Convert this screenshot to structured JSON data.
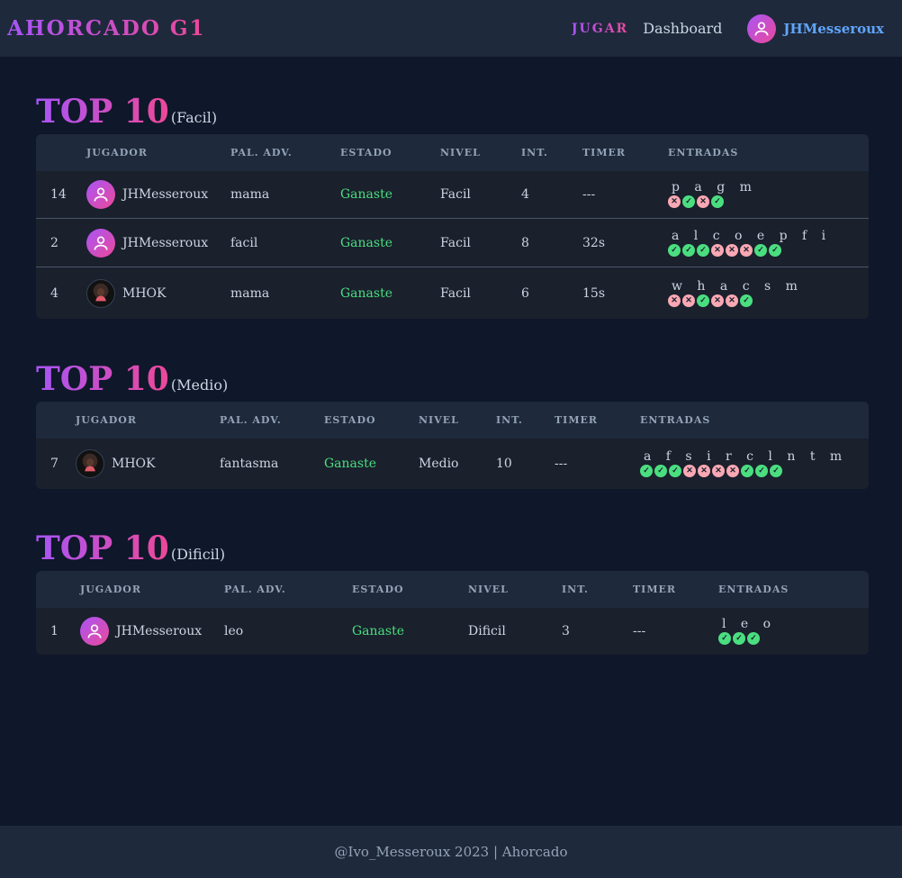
{
  "header": {
    "brand": "AHORCADO G1",
    "nav_play": "JUGAR",
    "nav_dashboard": "Dashboard",
    "username": "JHMesseroux"
  },
  "columns": [
    "JUGADOR",
    "PAL. ADV.",
    "ESTADO",
    "NIVEL",
    "INT.",
    "TIMER",
    "ENTRADAS"
  ],
  "sections": [
    {
      "title": "TOP 10",
      "level": "(Facil)",
      "rows": [
        {
          "rank": "14",
          "player": "JHMesseroux",
          "avatar": "user",
          "word": "mama",
          "status": "Ganaste",
          "level": "Facil",
          "attempts": "4",
          "timer": "---",
          "letters": "p a g m",
          "marks": [
            "bad",
            "ok",
            "bad",
            "ok"
          ]
        },
        {
          "rank": "2",
          "player": "JHMesseroux",
          "avatar": "user",
          "word": "facil",
          "status": "Ganaste",
          "level": "Facil",
          "attempts": "8",
          "timer": "32s",
          "letters": "a l c o e p f i",
          "marks": [
            "ok",
            "ok",
            "ok",
            "bad",
            "bad",
            "bad",
            "ok",
            "ok"
          ]
        },
        {
          "rank": "4",
          "player": "MHOK",
          "avatar": "photo",
          "word": "mama",
          "status": "Ganaste",
          "level": "Facil",
          "attempts": "6",
          "timer": "15s",
          "letters": "w h a c s m",
          "marks": [
            "bad",
            "bad",
            "ok",
            "bad",
            "bad",
            "ok"
          ]
        }
      ]
    },
    {
      "title": "TOP 10",
      "level": "(Medio)",
      "rows": [
        {
          "rank": "7",
          "player": "MHOK",
          "avatar": "photo",
          "word": "fantasma",
          "status": "Ganaste",
          "level": "Medio",
          "attempts": "10",
          "timer": "---",
          "letters": "a f s i r c l n t m",
          "marks": [
            "ok",
            "ok",
            "ok",
            "bad",
            "bad",
            "bad",
            "bad",
            "ok",
            "ok",
            "ok"
          ]
        }
      ]
    },
    {
      "title": "TOP 10",
      "level": "(Dificil)",
      "rows": [
        {
          "rank": "1",
          "player": "JHMesseroux",
          "avatar": "user",
          "word": "leo",
          "status": "Ganaste",
          "level": "Dificil",
          "attempts": "3",
          "timer": "---",
          "letters": "l e o",
          "marks": [
            "ok",
            "ok",
            "ok"
          ]
        }
      ]
    }
  ],
  "footer": "@Ivo_Messeroux 2023 | Ahorcado",
  "colors": {
    "accent_from": "#a855f7",
    "accent_to": "#ec4899",
    "win": "#4ade80",
    "miss": "#f9a8b4",
    "link": "#60a5fa"
  }
}
